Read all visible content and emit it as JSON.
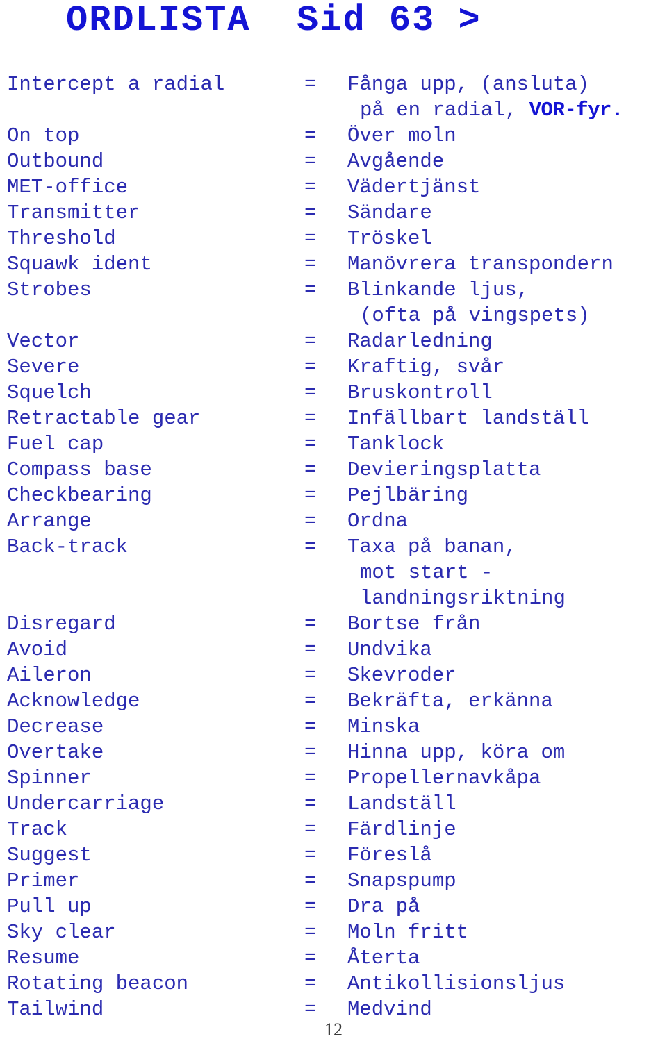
{
  "document": {
    "title": "ORDLISTA  Sid 63 >",
    "page_number": "12",
    "accent_color": "#1414d4",
    "body_color": "#2b2bb0",
    "equals_sign": "=",
    "rows": [
      {
        "term": "Intercept a radial",
        "eq": "=",
        "def": "Fånga upp, (ansluta)"
      },
      {
        "term": "",
        "eq": "",
        "def": "",
        "cont": "på en radial, ",
        "cont_strong": "VOR-fyr."
      },
      {
        "term": "On top",
        "eq": "=",
        "def": "Över moln"
      },
      {
        "term": "Outbound",
        "eq": "=",
        "def": "Avgående"
      },
      {
        "term": "MET-office",
        "eq": "=",
        "def": "Vädertjänst"
      },
      {
        "term": "Transmitter",
        "eq": "=",
        "def": "Sändare"
      },
      {
        "term": "Threshold",
        "eq": "=",
        "def": "Tröskel"
      },
      {
        "term": "Squawk ident",
        "eq": "=",
        "def": "Manövrera transpondern"
      },
      {
        "term": "Strobes",
        "eq": "=",
        "def": "Blinkande ljus,"
      },
      {
        "term": "",
        "eq": "",
        "def": "",
        "cont": "(ofta på vingspets)"
      },
      {
        "term": "Vector",
        "eq": "=",
        "def": "Radarledning"
      },
      {
        "term": "Severe",
        "eq": "=",
        "def": "Kraftig, svår"
      },
      {
        "term": "Squelch",
        "eq": "=",
        "def": "Bruskontroll"
      },
      {
        "term": "Retractable gear",
        "eq": "=",
        "def": "Infällbart landställ"
      },
      {
        "term": "Fuel cap",
        "eq": "=",
        "def": "Tanklock"
      },
      {
        "term": "Compass base",
        "eq": "=",
        "def": "Devieringsplatta"
      },
      {
        "term": "Checkbearing",
        "eq": "=",
        "def": "Pejlbäring"
      },
      {
        "term": "Arrange",
        "eq": "=",
        "def": "Ordna"
      },
      {
        "term": "Back-track",
        "eq": "=",
        "def": "Taxa på banan,"
      },
      {
        "term": "",
        "eq": "",
        "def": "",
        "cont": "mot start -"
      },
      {
        "term": "",
        "eq": "",
        "def": "",
        "cont": "landningsriktning"
      },
      {
        "term": "Disregard",
        "eq": "=",
        "def": "Bortse från"
      },
      {
        "term": "Avoid",
        "eq": "=",
        "def": "Undvika"
      },
      {
        "term": "Aileron",
        "eq": "=",
        "def": "Skevroder"
      },
      {
        "term": "Acknowledge",
        "eq": "=",
        "def": "Bekräfta, erkänna"
      },
      {
        "term": "Decrease",
        "eq": "=",
        "def": "Minska"
      },
      {
        "term": "Overtake",
        "eq": "=",
        "def": "Hinna upp, köra om"
      },
      {
        "term": "Spinner",
        "eq": "=",
        "def": "Propellernavkåpa"
      },
      {
        "term": "Undercarriage",
        "eq": "=",
        "def": "Landställ"
      },
      {
        "term": "Track",
        "eq": "=",
        "def": "Färdlinje"
      },
      {
        "term": "Suggest",
        "eq": "=",
        "def": "Föreslå"
      },
      {
        "term": "Primer",
        "eq": "=",
        "def": "Snapspump"
      },
      {
        "term": "Pull up",
        "eq": "=",
        "def": "Dra på"
      },
      {
        "term": "Sky clear",
        "eq": "=",
        "def": "Moln fritt"
      },
      {
        "term": "Resume",
        "eq": "=",
        "def": "Återta"
      },
      {
        "term": "Rotating beacon",
        "eq": "=",
        "def": "Antikollisionsljus"
      },
      {
        "term": "Tailwind",
        "eq": "=",
        "def": "Medvind"
      }
    ]
  }
}
